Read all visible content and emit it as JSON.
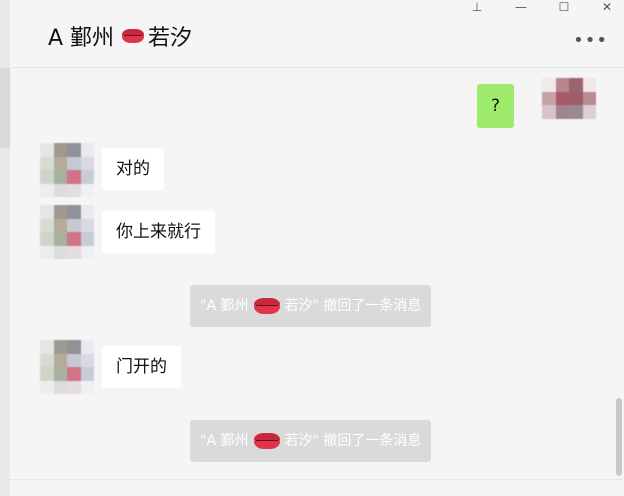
{
  "header": {
    "title_prefix": "A 鄞州",
    "title_suffix": "若汐",
    "more_label": "•••"
  },
  "window_controls": {
    "pin": "⊥",
    "minimize": "—",
    "maximize": "☐",
    "close": "✕"
  },
  "messages": {
    "outgoing_1": "?",
    "incoming_1": "对的",
    "incoming_2": "你上来就行",
    "recall_1": {
      "prefix": "\"A 鄞州",
      "suffix": "若汐\" 撤回了一条消息"
    },
    "incoming_3": "门开的",
    "recall_2": {
      "prefix": "\"A 鄞州",
      "suffix": "若汐\" 撤回了一条消息"
    }
  },
  "colors": {
    "background": "#f5f5f5",
    "outgoing_bubble": "#9eea6a",
    "incoming_bubble": "#ffffff",
    "recall_notice": "#dadada",
    "lips": "#d23042"
  },
  "icons": {
    "lips": "kiss-lips-emoji",
    "more": "more-dots-icon"
  }
}
